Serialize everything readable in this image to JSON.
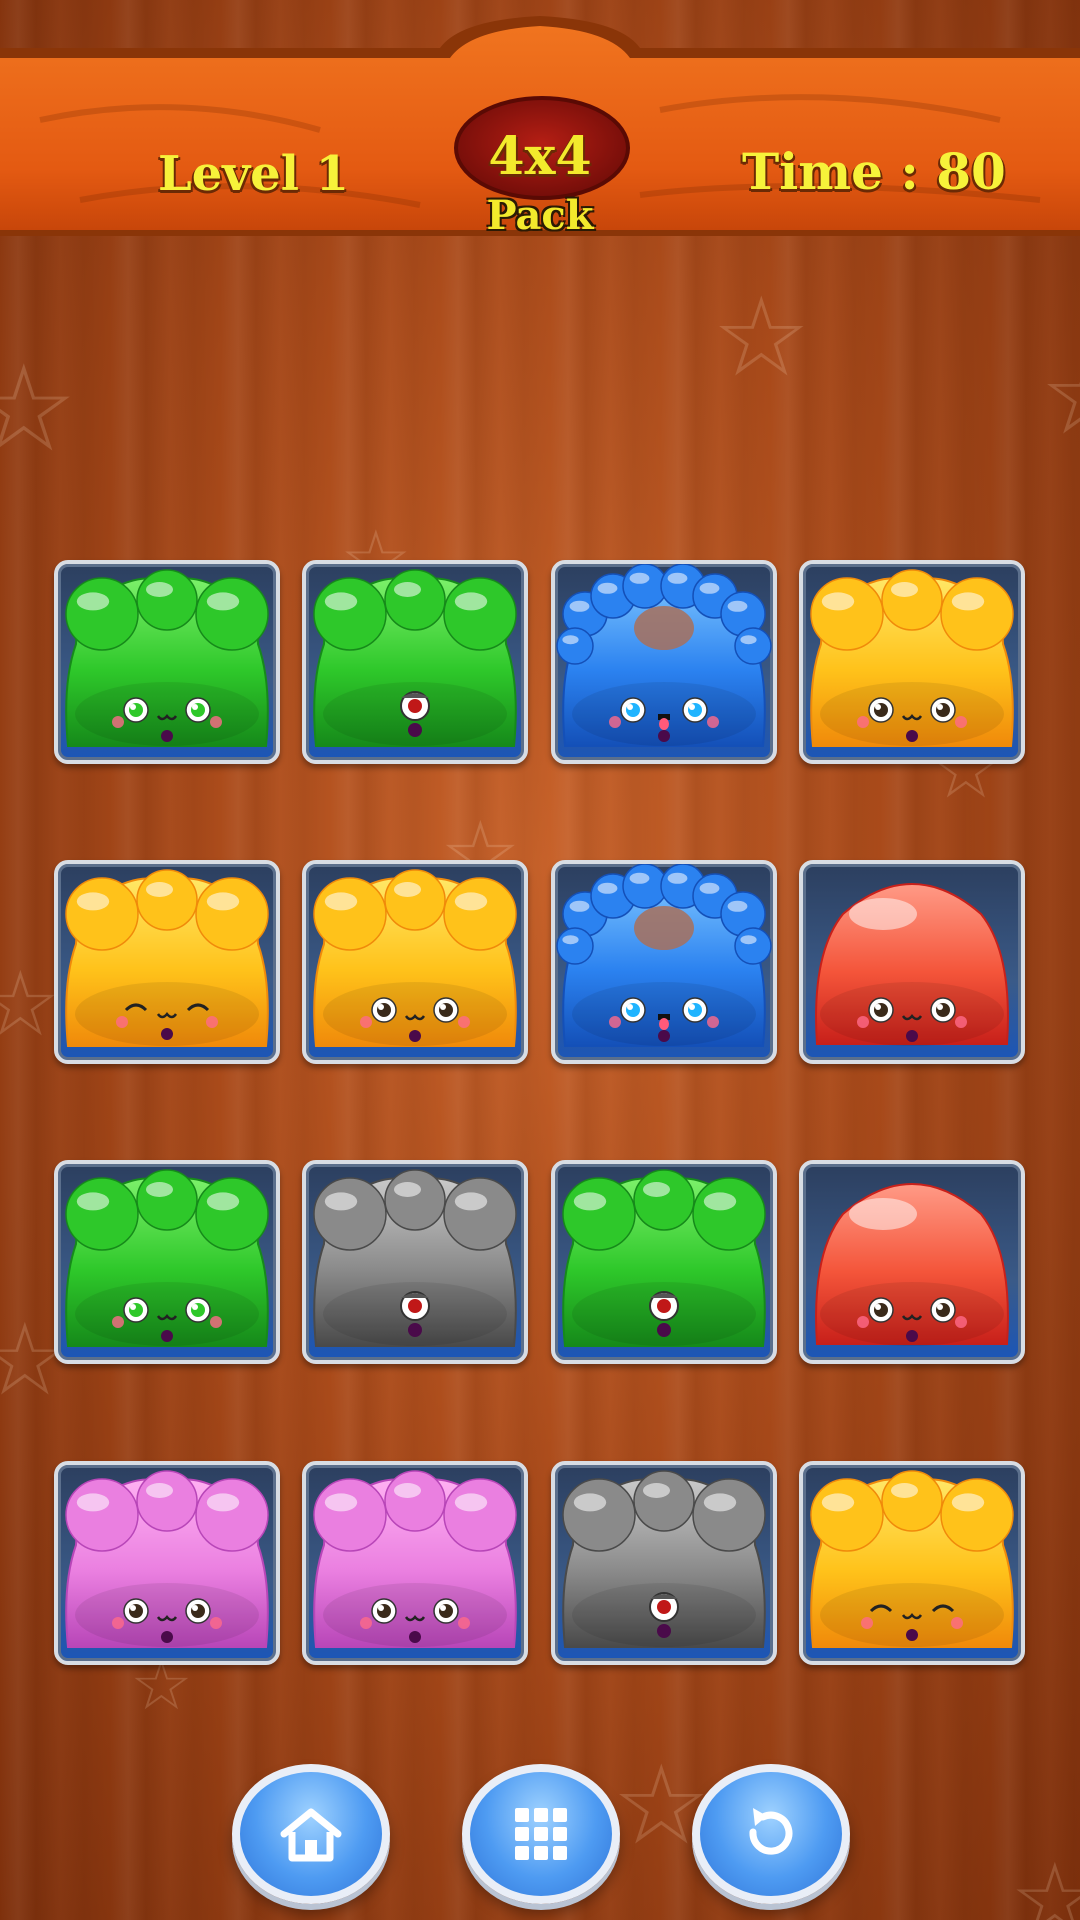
{
  "header": {
    "level_label": "Level 1",
    "pack_size": "4x4",
    "pack_label": "Pack",
    "time_label": "Time : 80"
  },
  "board": {
    "rows": 4,
    "cols": 4,
    "tiles": [
      {
        "color": "green",
        "face": "eyes"
      },
      {
        "color": "green",
        "face": "cyclops"
      },
      {
        "color": "blue",
        "face": "tongue"
      },
      {
        "color": "yellow",
        "face": "eyes"
      },
      {
        "color": "yellow",
        "face": "happy"
      },
      {
        "color": "yellow",
        "face": "eyes"
      },
      {
        "color": "blue",
        "face": "tongue"
      },
      {
        "color": "red",
        "face": "eyes"
      },
      {
        "color": "green",
        "face": "eyes"
      },
      {
        "color": "gray",
        "face": "cyclops"
      },
      {
        "color": "green",
        "face": "cyclops"
      },
      {
        "color": "red",
        "face": "eyes"
      },
      {
        "color": "pink",
        "face": "eyes"
      },
      {
        "color": "pink",
        "face": "eyes"
      },
      {
        "color": "gray",
        "face": "cyclops"
      },
      {
        "color": "yellow",
        "face": "happy"
      }
    ]
  },
  "jelly_colors": {
    "green": {
      "light": "#7cf06a",
      "main": "#2ec82a",
      "dark": "#168a1a"
    },
    "blue": {
      "light": "#7cc4ff",
      "main": "#2b82f0",
      "dark": "#1450b8"
    },
    "yellow": {
      "light": "#ffe766",
      "main": "#ffc21a",
      "dark": "#f08a0a"
    },
    "red": {
      "light": "#ff9a86",
      "main": "#f4553a",
      "dark": "#c8201a"
    },
    "gray": {
      "light": "#c9c9c9",
      "main": "#8a8a8a",
      "dark": "#4a4a4a"
    },
    "pink": {
      "light": "#ffb0f2",
      "main": "#ea7fe0",
      "dark": "#b846b8"
    }
  },
  "buttons": [
    {
      "name": "home-button",
      "icon": "home-icon"
    },
    {
      "name": "level-select-button",
      "icon": "grid-icon"
    },
    {
      "name": "restart-button",
      "icon": "restart-icon"
    }
  ]
}
